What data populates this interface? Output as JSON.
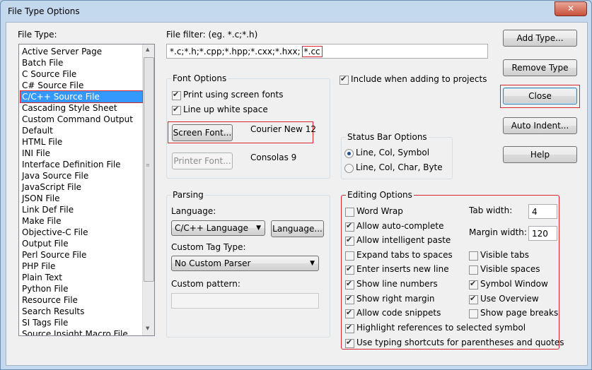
{
  "window": {
    "title": "File Type Options",
    "close_glyph": "✕"
  },
  "file_type": {
    "label": "File Type:",
    "items": [
      "Active Server Page",
      "Batch File",
      "C Source File",
      "C# Source File",
      "C/C++ Source File",
      "Cascading Style Sheet",
      "Custom Command Output",
      "Default",
      "HTML File",
      "INI File",
      "Interface Definition File",
      "Java Source File",
      "JavaScript File",
      "JSON File",
      "Link Def File",
      "Make File",
      "Objective-C File",
      "Output File",
      "Perl Source File",
      "PHP File",
      "Plain Text",
      "Python File",
      "Resource File",
      "Search Results",
      "SI Tags File",
      "Source Insight Macro File"
    ],
    "selected": "C/C++ Source File"
  },
  "file_filter": {
    "label": "File filter: (eg. *.c;*.h)",
    "value": "*.c;*.h;*.cpp;*.hpp;*.cxx;*.hxx;",
    "value_highlight": "*.cc"
  },
  "font_options": {
    "title": "Font Options",
    "print_screen_fonts": "Print using screen fonts",
    "line_up_whitespace": "Line up white space",
    "screen_font_button": "Screen Font...",
    "screen_font_value": "Courier New 12",
    "printer_font_button": "Printer Font...",
    "printer_font_value": "Consolas 9"
  },
  "include_projects": "Include when adding to projects",
  "status_bar": {
    "title": "Status Bar Options",
    "option1": "Line, Col, Symbol",
    "option2": "Line, Col, Char, Byte"
  },
  "parsing": {
    "title": "Parsing",
    "language_label": "Language:",
    "language_value": "C/C++ Language",
    "language_button": "Language...",
    "tag_type_label": "Custom Tag Type:",
    "tag_type_value": "No Custom Parser",
    "pattern_label": "Custom pattern:",
    "pattern_value": ""
  },
  "editing": {
    "title": "Editing Options",
    "word_wrap": "Word Wrap",
    "auto_complete": "Allow auto-complete",
    "intelligent_paste": "Allow intelligent paste",
    "expand_tabs": "Expand tabs to spaces",
    "enter_inserts": "Enter inserts new line",
    "show_line_numbers": "Show line numbers",
    "show_right_margin": "Show right margin",
    "code_snippets": "Allow code snippets",
    "highlight_refs": "Highlight references to selected symbol",
    "typing_shortcuts": "Use typing shortcuts for parentheses and quotes",
    "tab_width_label": "Tab width:",
    "tab_width_value": "4",
    "margin_width_label": "Margin width:",
    "margin_width_value": "120",
    "visible_tabs": "Visible tabs",
    "visible_spaces": "Visible spaces",
    "symbol_window": "Symbol Window",
    "use_overview": "Use Overview",
    "show_page_breaks": "Show page breaks"
  },
  "buttons": {
    "add_type": "Add Type...",
    "remove_type": "Remove Type",
    "close": "Close",
    "auto_indent": "Auto Indent...",
    "help": "Help"
  },
  "colors": {
    "selection": "#3399ff",
    "highlight_border": "#d9252c"
  }
}
